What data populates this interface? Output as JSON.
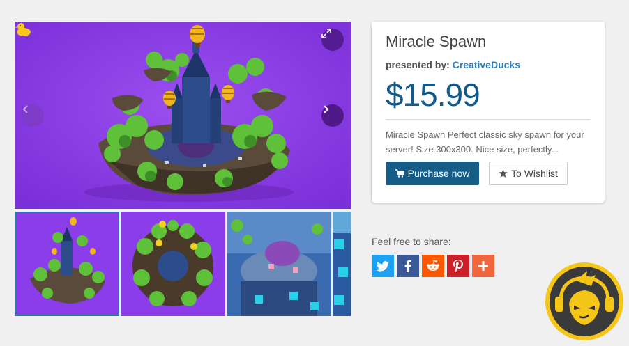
{
  "product": {
    "title": "Miracle Spawn",
    "presented_prefix": "presented by:",
    "author": "CreativeDucks",
    "price": "$15.99",
    "description": "Miracle Spawn Perfect classic sky spawn for your server! Size 300x300. Nice size, perfectly..."
  },
  "actions": {
    "purchase_label": "Purchase now",
    "wishlist_label": "To Wishlist"
  },
  "share": {
    "label": "Feel free to share:",
    "networks": [
      "twitter",
      "facebook",
      "reddit",
      "pinterest",
      "more"
    ]
  },
  "gallery": {
    "thumbnails": [
      "Miracle Spawn castle view",
      "Miracle Spawn top view",
      "Miracle Spawn interior view",
      "Miracle Spawn partial view"
    ],
    "active_index": 0
  },
  "colors": {
    "accent": "#155c87",
    "price": "#0f5a8a",
    "author_link": "#2680bf",
    "hero_bg": "#8a3de8",
    "twitter": "#1da1f2",
    "facebook": "#3b5998",
    "reddit": "#ff5700",
    "pinterest": "#cb2027",
    "more": "#f0663d"
  },
  "icons": [
    "chevron-left-icon",
    "chevron-right-icon",
    "expand-icon",
    "duck-icon",
    "cart-icon",
    "star-icon",
    "twitter-icon",
    "facebook-icon",
    "reddit-icon",
    "pinterest-icon",
    "plus-icon",
    "avatar-icon"
  ]
}
